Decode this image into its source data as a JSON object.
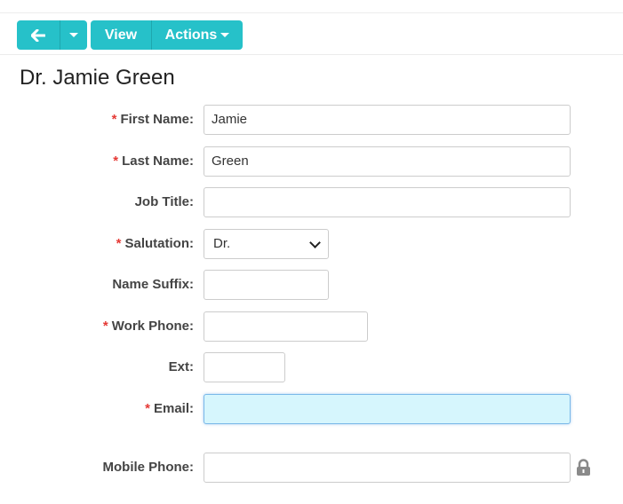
{
  "toolbar": {
    "back_icon": "arrow-left-icon",
    "dropdown_icon": "caret-down-icon",
    "view_label": "View",
    "actions_label": "Actions"
  },
  "page": {
    "title": "Dr. Jamie Green"
  },
  "form": {
    "first_name": {
      "label": "First Name:",
      "required": true,
      "value": "Jamie"
    },
    "last_name": {
      "label": "Last Name:",
      "required": true,
      "value": "Green"
    },
    "job_title": {
      "label": "Job Title:",
      "required": false,
      "value": ""
    },
    "salutation": {
      "label": "Salutation:",
      "required": true,
      "value": "Dr."
    },
    "name_suffix": {
      "label": "Name Suffix:",
      "required": false,
      "value": ""
    },
    "work_phone": {
      "label": "Work Phone:",
      "required": true,
      "value": ""
    },
    "ext": {
      "label": "Ext:",
      "required": false,
      "value": ""
    },
    "email": {
      "label": "Email:",
      "required": true,
      "value": ""
    },
    "mobile_phone": {
      "label": "Mobile Phone:",
      "required": false,
      "value": "",
      "icon": "lock-icon"
    }
  },
  "required_marker": "*",
  "colors": {
    "accent": "#26c1c9",
    "required": "#e53935",
    "focus_bg": "#d6f6fd"
  }
}
